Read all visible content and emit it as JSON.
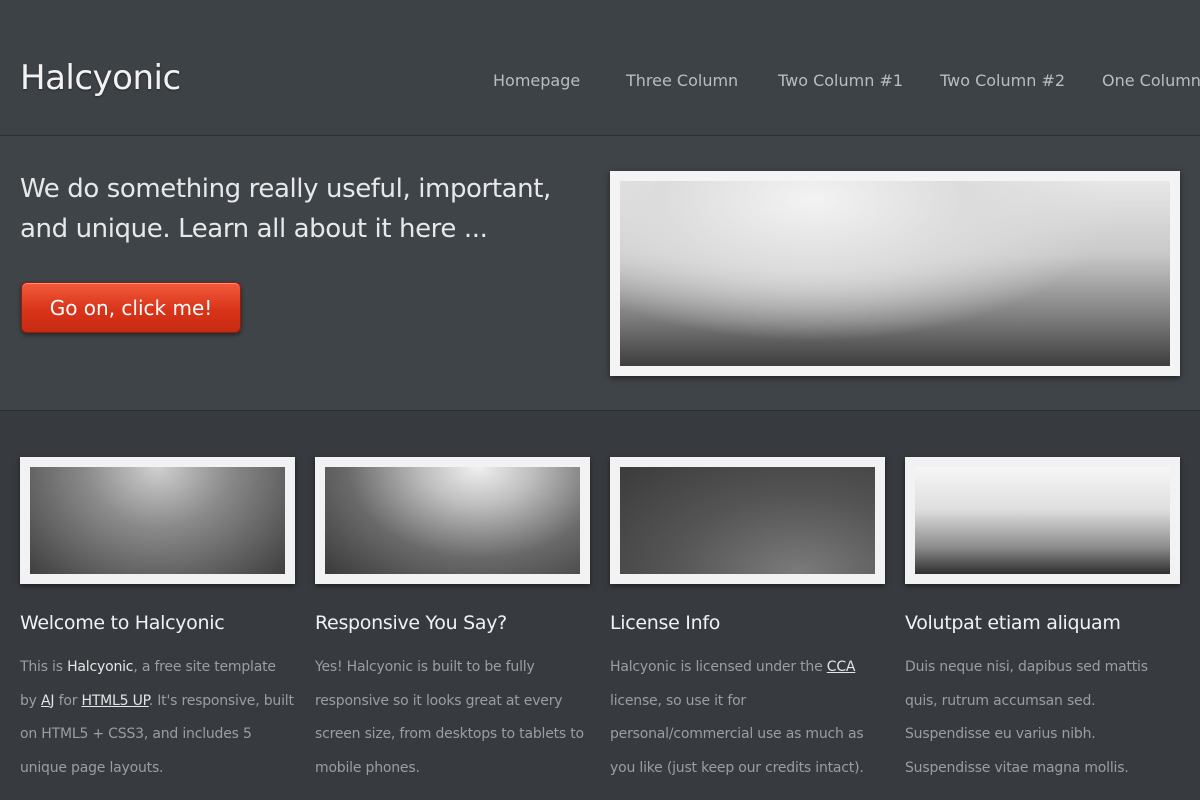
{
  "header": {
    "logo": "Halcyonic",
    "nav": [
      "Homepage",
      "Three Column",
      "Two Column #1",
      "Two Column #2",
      "One Column"
    ]
  },
  "banner": {
    "tagline": "We do something really useful, important, and unique. Learn all about it here ...",
    "cta_label": "Go on, click me!"
  },
  "columns": [
    {
      "title": "Welcome to Halcyonic",
      "text_1": "This is ",
      "bold": "Halcyonic",
      "text_2": ", a free site template by ",
      "link_1": "AJ",
      "text_3": " for ",
      "link_2": "HTML5 UP",
      "text_4": ". It's responsive, built on HTML5 + CSS3, and includes 5 unique page layouts."
    },
    {
      "title": "Responsive You Say?",
      "text": "Yes! Halcyonic is built to be fully responsive so it looks great at every screen size, from desktops to tablets to mobile phones."
    },
    {
      "title": "License Info",
      "text_1": "Halcyonic is licensed under the ",
      "link": "CCA",
      "text_2": " license, so use it for personal/commercial use as much as you like (just keep our credits intact)."
    },
    {
      "title": "Volutpat etiam aliquam",
      "text": "Duis neque nisi, dapibus sed mattis quis, rutrum accumsan sed. Suspendisse eu varius nibh. Suspendisse vitae magna mollis."
    }
  ],
  "colors": {
    "background": "#35393d",
    "cta": "#d9341a"
  }
}
